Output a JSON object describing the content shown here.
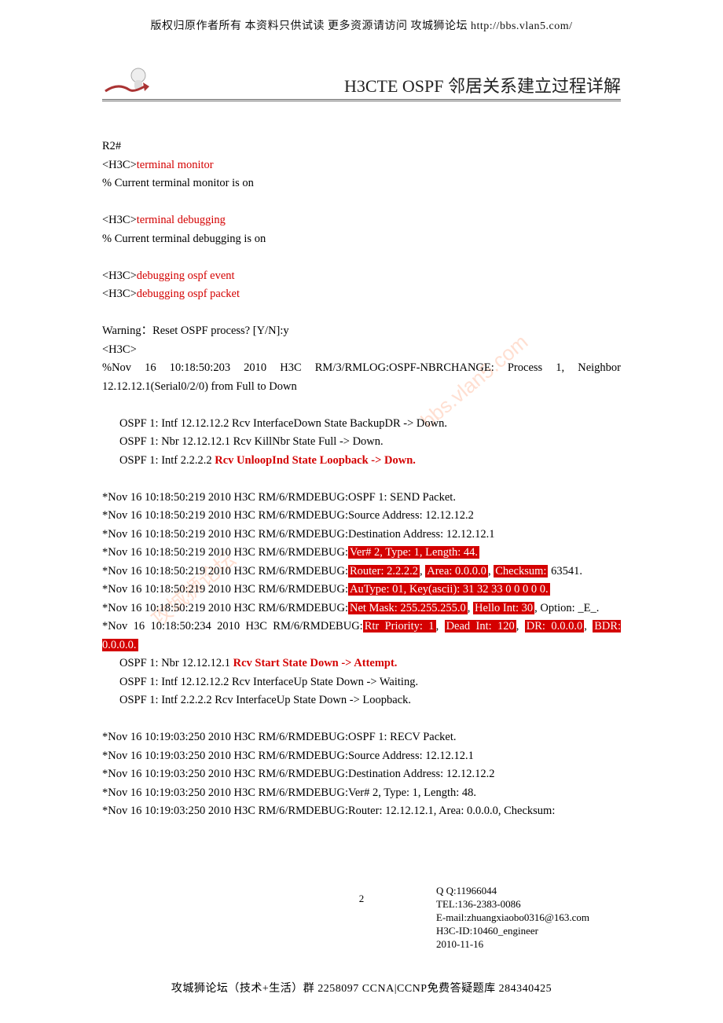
{
  "top_note": "版权归原作者所有 本资料只供试读 更多资源请访问 攻城狮论坛 http://bbs.vlan5.com/",
  "header_title": "H3CTE OSPF 邻居关系建立过程详解",
  "watermark_top": "bbs.vlan5.com",
  "watermark_bot": "攻城狮论坛",
  "lines": {
    "l1": "R2#",
    "l2a": "<H3C>",
    "l2b": "terminal monitor",
    "l3": "% Current terminal monitor is on",
    "l4a": "<H3C>",
    "l4b": "terminal debugging",
    "l5": "% Current terminal debugging is on",
    "l6a": "<H3C>",
    "l6b": "debugging ospf event",
    "l7a": "<H3C>",
    "l7b": "debugging ospf packet",
    "l8": "Warning：Reset OSPF process? [Y/N]:y",
    "l9": "<H3C>",
    "l10": "%Nov 16 10:18:50:203 2010 H3C RM/3/RMLOG:OSPF-NBRCHANGE: Process 1, Neighbor 12.12.12.1(Serial0/2/0) from Full to Down",
    "l11": "OSPF 1: Intf 12.12.12.2 Rcv InterfaceDown State BackupDR -> Down.",
    "l12": "OSPF 1: Nbr 12.12.12.1 Rcv KillNbr State Full -> Down.",
    "l13a": "OSPF 1: Intf 2.2.2.2 ",
    "l13b": "Rcv UnloopInd State Loopback -> Down.",
    "l14": "*Nov 16 10:18:50:219 2010 H3C RM/6/RMDEBUG:OSPF 1: SEND Packet.",
    "l15": "*Nov 16 10:18:50:219 2010 H3C RM/6/RMDEBUG:Source Address: 12.12.12.2",
    "l16": "*Nov 16 10:18:50:219 2010 H3C RM/6/RMDEBUG:Destination Address: 12.12.12.1",
    "l17a": "*Nov 16 10:18:50:219 2010 H3C RM/6/RMDEBUG:",
    "l17b": "Ver# 2, Type: 1, Length: 44.",
    "l18a": "*Nov 16 10:18:50:219 2010 H3C RM/6/RMDEBUG:",
    "l18b": "Router: 2.2.2.2",
    "l18c": ", ",
    "l18d": "Area: 0.0.0.0",
    "l18e": ", ",
    "l18f": "Checksum:",
    "l18g": " 63541.",
    "l19a": "*Nov 16 10:18:50:219 2010 H3C RM/6/RMDEBUG:",
    "l19b": "AuType: 01, Key(ascii): 31 32 33 0 0 0 0 0.",
    "l20a": "*Nov 16 10:18:50:219 2010 H3C RM/6/RMDEBUG:",
    "l20b": "Net Mask: 255.255.255.0",
    "l20c": ", ",
    "l20d": "Hello Int: 30",
    "l20e": ", Option: _E_.",
    "l21a": "*Nov 16 10:18:50:234 2010 H3C RM/6/RMDEBUG:",
    "l21b": "Rtr Priority: 1",
    "l21c": ", ",
    "l21d": "Dead Int: 120",
    "l21e": ", ",
    "l21f": "DR: 0.0.0.0",
    "l21g": ", ",
    "l21h": "BDR: 0.0.0.0.",
    "l22a": "OSPF 1: Nbr 12.12.12.1 ",
    "l22b": "Rcv Start State Down -> Attempt.",
    "l23": "OSPF 1: Intf 12.12.12.2 Rcv InterfaceUp State Down -> Waiting.",
    "l24": "OSPF 1: Intf 2.2.2.2 Rcv InterfaceUp State Down -> Loopback.",
    "l25": "*Nov 16 10:19:03:250 2010 H3C RM/6/RMDEBUG:OSPF 1: RECV Packet.",
    "l26": "*Nov 16 10:19:03:250 2010 H3C RM/6/RMDEBUG:Source Address: 12.12.12.1",
    "l27": "*Nov 16 10:19:03:250 2010 H3C RM/6/RMDEBUG:Destination Address: 12.12.12.2",
    "l28": "*Nov 16 10:19:03:250 2010 H3C RM/6/RMDEBUG:Ver# 2, Type: 1, Length: 48.",
    "l29": "*Nov 16 10:19:03:250 2010 H3C RM/6/RMDEBUG:Router: 12.12.12.1, Area: 0.0.0.0, Checksum:"
  },
  "page_number": "2",
  "footer": {
    "qq": "Q Q:11966044",
    "tel": "TEL:136-2383-0086",
    "email": "E-mail:zhuangxiaobo0316@163.com",
    "h3c": "H3C-ID:10460_engineer",
    "date": "2010-11-16"
  },
  "bottom_note": "攻城狮论坛（技术+生活）群 2258097 CCNA|CCNP免费答疑题库 284340425"
}
